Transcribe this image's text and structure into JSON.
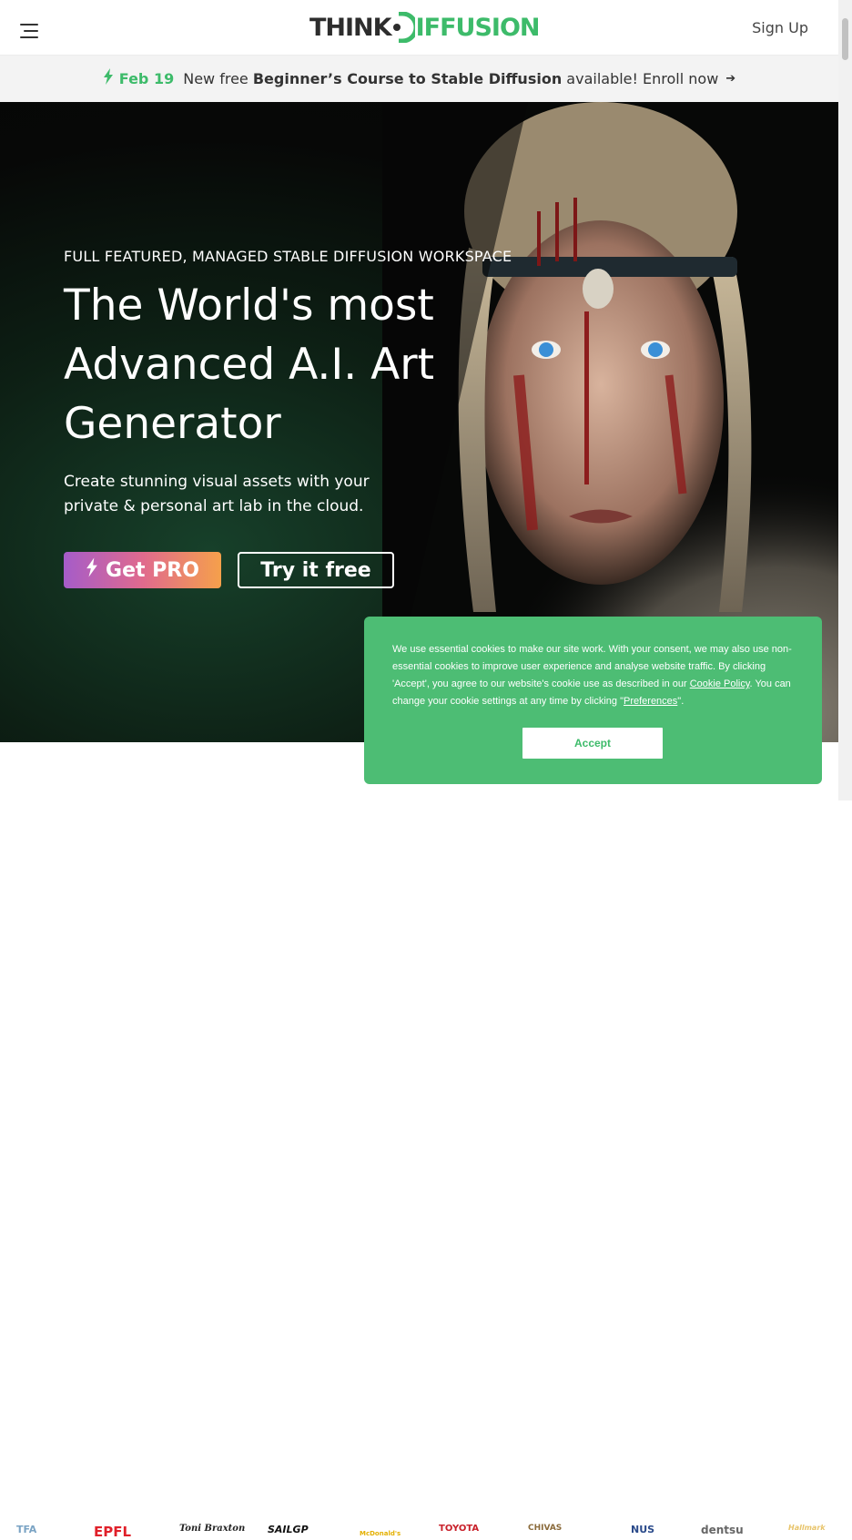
{
  "header": {
    "logo_think": "THINK",
    "logo_diffusion": "IFFUSION",
    "signup_label": "Sign Up"
  },
  "announcement": {
    "date": "Feb 19",
    "prefix": "New free",
    "course": "Beginner’s Course to Stable Diffusion",
    "suffix": "available! Enroll now",
    "arrow": "➔"
  },
  "hero": {
    "eyebrow": "FULL FEATURED, MANAGED STABLE DIFFUSION WORKSPACE",
    "headline_line1": "The World's most",
    "headline_line2": "Advanced A.I. Art",
    "headline_line3": "Generator",
    "subhead": "Create stunning visual assets with your private & personal art lab in the cloud.",
    "pro_label": "Get PRO",
    "free_label": "Try it free"
  },
  "logos": [
    "TFA",
    "EPFL",
    "Toni Braxton",
    "SAILGP",
    "McDonald's",
    "TOYOTA",
    "CHIVAS",
    "NUS",
    "dentsu",
    "Hallmark"
  ],
  "cookie": {
    "text_1": "We use essential cookies to make our site work. With your consent, we may also use non-essential cookies to improve user experience and analyse website traffic. By clicking 'Accept', you agree to our website's cookie use as described in our ",
    "policy_link": "Cookie Policy",
    "text_2": ". You can change your cookie settings at any time by clicking \"",
    "preferences_link": "Preferences",
    "text_3": "\".",
    "accept_label": "Accept"
  },
  "colors": {
    "brand_green": "#3dbb6a",
    "cookie_bg": "#4dbd74"
  }
}
